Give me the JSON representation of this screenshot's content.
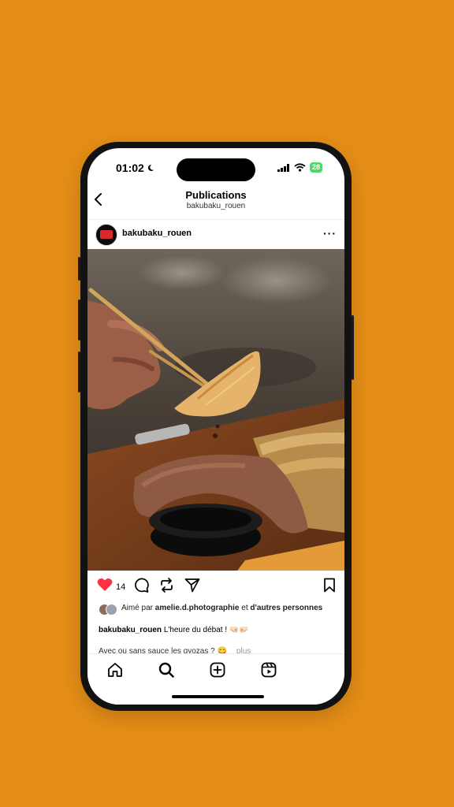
{
  "status": {
    "time": "01:02",
    "battery": "28"
  },
  "header": {
    "title": "Publications",
    "subtitle": "bakubaku_rouen"
  },
  "post": {
    "username": "bakubaku_rouen",
    "likes": "14",
    "liked_prefix": "Aimé par",
    "liked_user": "amelie.d.photographie",
    "liked_and": "et",
    "liked_others": "d'autres personnes",
    "caption_user": "bakubaku_rouen",
    "caption_text": "L'heure du débat ! 🤜🏻🤛🏻",
    "caption_line2": "Avec ou sans sauce les gyozas ? 😋",
    "more_label": "plus"
  },
  "icons": [
    "back-chevron-icon",
    "moon-icon",
    "signal-icon",
    "wifi-icon",
    "more-dots-icon",
    "heart-icon",
    "comment-icon",
    "repost-icon",
    "send-icon",
    "bookmark-icon",
    "home-icon",
    "search-icon",
    "create-icon",
    "reels-icon"
  ],
  "colors": {
    "background": "#E58E17",
    "like": "#ff3040",
    "battery": "#4cd964"
  }
}
